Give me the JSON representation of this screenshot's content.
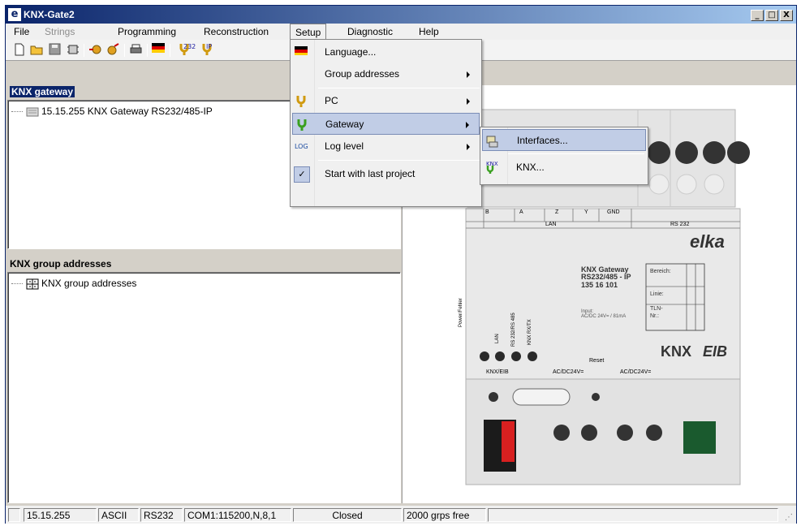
{
  "window": {
    "title": "KNX-Gate2",
    "app_icon": "elka-logo-icon",
    "buttons": [
      "_",
      "□",
      "X"
    ]
  },
  "menubar": {
    "items": [
      {
        "label": "File",
        "enabled": true
      },
      {
        "label": "Strings",
        "enabled": false
      },
      {
        "label": "Programming",
        "enabled": true
      },
      {
        "label": "Reconstruction",
        "enabled": true
      },
      {
        "label": "Setup",
        "enabled": true,
        "open": true
      },
      {
        "label": "Diagnostic",
        "enabled": true
      },
      {
        "label": "Help",
        "enabled": true
      }
    ]
  },
  "toolbar": {
    "icons": [
      "new-document-icon",
      "open-folder-icon",
      "save-icon",
      "device-icon",
      "read-icon",
      "program-icon",
      "print-icon",
      "language-flag-icon",
      "rs232-gateway-icon",
      "ip-gateway-icon"
    ],
    "rs232_badge": "232",
    "ip_badge": "IP"
  },
  "panels": {
    "gateway": {
      "header": "KNX gateway",
      "items": [
        "15.15.255 KNX Gateway RS232/485-IP"
      ]
    },
    "group_addresses": {
      "header": "KNX group addresses",
      "items": [
        "KNX group addresses"
      ]
    }
  },
  "setup_menu": {
    "items": [
      {
        "label": "Language...",
        "icon": "flag-icon",
        "submenu": false
      },
      {
        "label": "Group addresses",
        "icon": "",
        "submenu": true
      },
      {
        "label": "PC",
        "icon": "yellow-plug-icon",
        "submenu": true
      },
      {
        "label": "Gateway",
        "icon": "green-plug-icon",
        "submenu": true,
        "highlighted": true
      },
      {
        "label": "Log level",
        "icon": "log-icon",
        "submenu": true
      },
      {
        "label": "Start with last project",
        "icon": "checkmark-icon",
        "submenu": false,
        "checked": true
      }
    ]
  },
  "gateway_submenu": {
    "items": [
      {
        "label": "Interfaces...",
        "icon": "interfaces-icon",
        "highlighted": true
      },
      {
        "label": "KNX...",
        "icon": "knx-icon"
      }
    ],
    "knx_badge": "KNX"
  },
  "device": {
    "brand": "elka",
    "model_line1": "KNX Gateway",
    "model_line2": "RS232/485 - IP",
    "article": "135 16 101",
    "input_line1": "Input:",
    "input_line2": "AC/DC 24V= / 81mA",
    "fields": [
      "Bereich:",
      "Linie:",
      "TLN-",
      "Nr.:"
    ],
    "terminals_top": [
      "B",
      "A",
      "Z",
      "Y",
      "GND"
    ],
    "group_lan": "LAN",
    "group_rs232": "RS 232",
    "leds": [
      "Power/Fehler",
      "LAN",
      "RS 232/RS 485",
      "KNX RX/TX"
    ],
    "reset": "Reset",
    "bottom_labels": [
      "KNX/EIB",
      "AC/DC24V=",
      "AC/DC24V="
    ],
    "knx_logo": "KNX",
    "eib_logo": "EIB",
    "colors": {
      "housing": "#e9e9e9",
      "terminal_red": "#d82020",
      "terminal_green": "#1a5a2e"
    }
  },
  "statusbar": {
    "cells": [
      "",
      "15.15.255",
      "ASCII",
      "RS232",
      "COM1:115200,N,8,1",
      "Closed",
      "2000 grps free",
      ""
    ]
  },
  "colors": {
    "titlebar": "#0a246a",
    "selection": "#0a246a",
    "menu_highlight": "#c1cde6"
  }
}
